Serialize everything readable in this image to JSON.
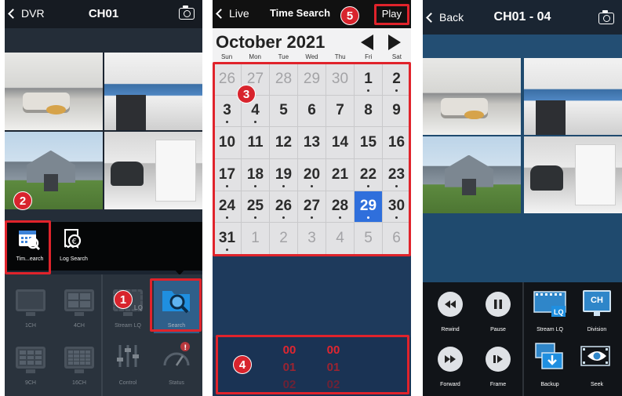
{
  "panel1": {
    "nav": {
      "back_label": "DVR",
      "title": "CH01"
    },
    "popup": {
      "time_search": "Tim...earch",
      "log_search": "Log Search"
    },
    "grid": [
      "1CH",
      "4CH",
      "Stream LQ",
      "Search",
      "9CH",
      "16CH",
      "Control",
      "Status"
    ],
    "stream_badge": "LQ",
    "badges": {
      "one": "1",
      "two": "2"
    }
  },
  "panel2": {
    "nav": {
      "back_label": "Live",
      "title": "Time Search",
      "play_label": "Play"
    },
    "month": "October 2021",
    "weekdays": [
      "Sun",
      "Mon",
      "Tue",
      "Wed",
      "Thu",
      "Fri",
      "Sat"
    ],
    "calendar": [
      {
        "d": "26",
        "muted": true
      },
      {
        "d": "27",
        "muted": true
      },
      {
        "d": "28",
        "muted": true
      },
      {
        "d": "29",
        "muted": true
      },
      {
        "d": "30",
        "muted": true
      },
      {
        "d": "1",
        "dot": true
      },
      {
        "d": "2",
        "dot": true
      },
      {
        "d": "3",
        "dot": true
      },
      {
        "d": "4",
        "dot": true
      },
      {
        "d": "5"
      },
      {
        "d": "6"
      },
      {
        "d": "7"
      },
      {
        "d": "8"
      },
      {
        "d": "9"
      },
      {
        "d": "10"
      },
      {
        "d": "11"
      },
      {
        "d": "12"
      },
      {
        "d": "13"
      },
      {
        "d": "14"
      },
      {
        "d": "15"
      },
      {
        "d": "16"
      },
      {
        "d": "17",
        "dot": true
      },
      {
        "d": "18",
        "dot": true
      },
      {
        "d": "19",
        "dot": true
      },
      {
        "d": "20",
        "dot": true
      },
      {
        "d": "21"
      },
      {
        "d": "22",
        "dot": true
      },
      {
        "d": "23",
        "dot": true
      },
      {
        "d": "24",
        "dot": true
      },
      {
        "d": "25",
        "dot": true
      },
      {
        "d": "26",
        "dot": true
      },
      {
        "d": "27",
        "dot": true
      },
      {
        "d": "28",
        "dot": true
      },
      {
        "d": "29",
        "dot": true,
        "selected": true
      },
      {
        "d": "30",
        "dot": true
      },
      {
        "d": "31",
        "dot": true
      },
      {
        "d": "1",
        "muted": true
      },
      {
        "d": "2",
        "muted": true
      },
      {
        "d": "3",
        "muted": true
      },
      {
        "d": "4",
        "muted": true
      },
      {
        "d": "5",
        "muted": true
      },
      {
        "d": "6",
        "muted": true
      }
    ],
    "picker": {
      "col1": [
        "00",
        "01",
        "02"
      ],
      "col2": [
        "00",
        "01",
        "02"
      ]
    },
    "badges": {
      "three": "3",
      "four": "4",
      "five": "5"
    }
  },
  "panel3": {
    "nav": {
      "back_label": "Back",
      "title": "CH01 - 04"
    },
    "controls": [
      "Rewind",
      "Pause",
      "Stream LQ",
      "Division",
      "Forward",
      "Frame",
      "Backup",
      "Seek"
    ],
    "stream_badge": "LQ",
    "division_badge": "CH"
  },
  "colors": {
    "highlight": "#e0232b",
    "selected_day": "#2f6fdc",
    "accent_blue": "#1f8fe0"
  }
}
